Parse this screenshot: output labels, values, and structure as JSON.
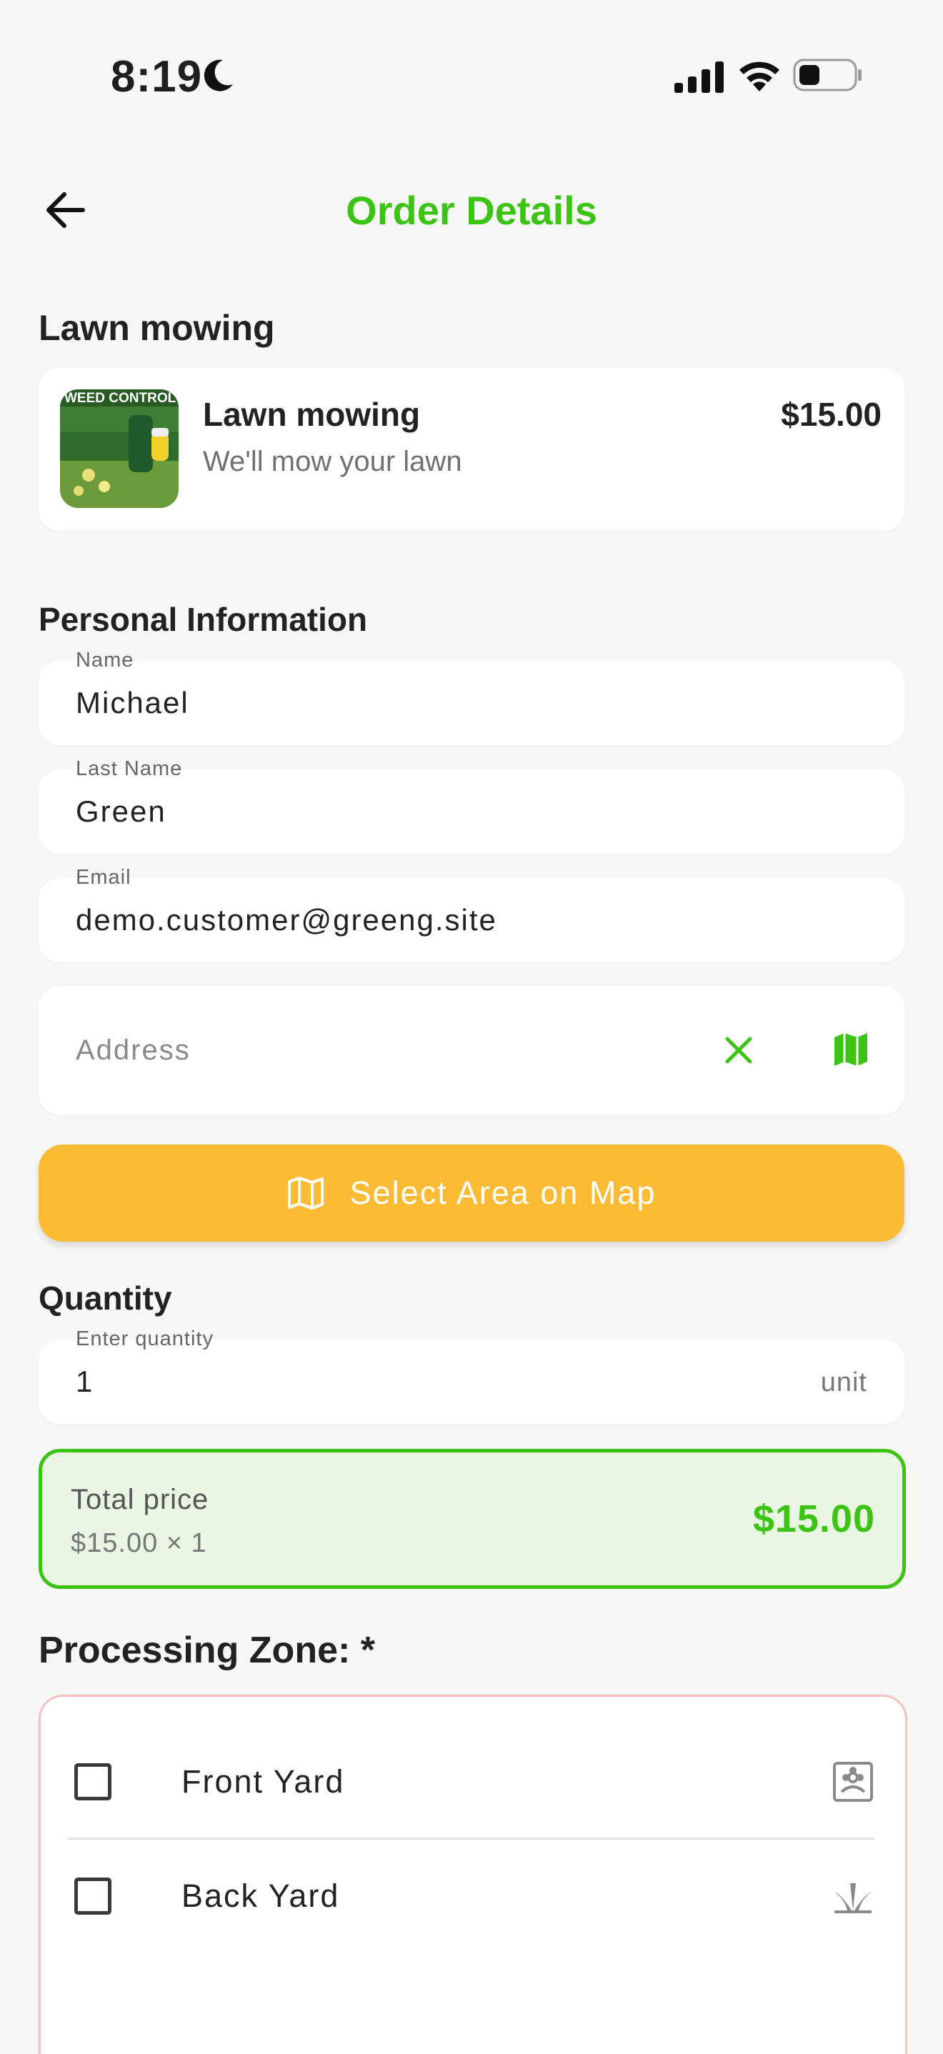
{
  "status_bar": {
    "time": "8:19"
  },
  "header": {
    "title": "Order Details"
  },
  "service_section": {
    "title": "Lawn mowing",
    "card": {
      "name": "Lawn mowing",
      "description": "We'll mow your lawn",
      "price": "$15.00",
      "thumbnail_text": "WEED CONTROL"
    }
  },
  "personal_info": {
    "title": "Personal Information",
    "name": {
      "label": "Name",
      "value": "Michael"
    },
    "last_name": {
      "label": "Last Name",
      "value": "Green"
    },
    "email": {
      "label": "Email",
      "value": "demo.customer@greeng.site"
    },
    "address": {
      "placeholder": "Address",
      "value": ""
    }
  },
  "map_button": {
    "label": "Select Area on Map"
  },
  "quantity": {
    "title": "Quantity",
    "label": "Enter quantity",
    "value": "1",
    "unit": "unit"
  },
  "total": {
    "label": "Total price",
    "breakdown": "$15.00 × 1",
    "price": "$15.00"
  },
  "processing_zone": {
    "title": "Processing Zone: *",
    "options": [
      {
        "label": "Front Yard",
        "checked": false,
        "icon": "house-flower-icon"
      },
      {
        "label": "Back Yard",
        "checked": false,
        "icon": "grass-icon"
      }
    ]
  },
  "colors": {
    "accent_green": "#3cc415",
    "button_yellow": "#fcbb35",
    "total_bg": "#e8f6e3",
    "zone_border": "#f4c0c0"
  }
}
